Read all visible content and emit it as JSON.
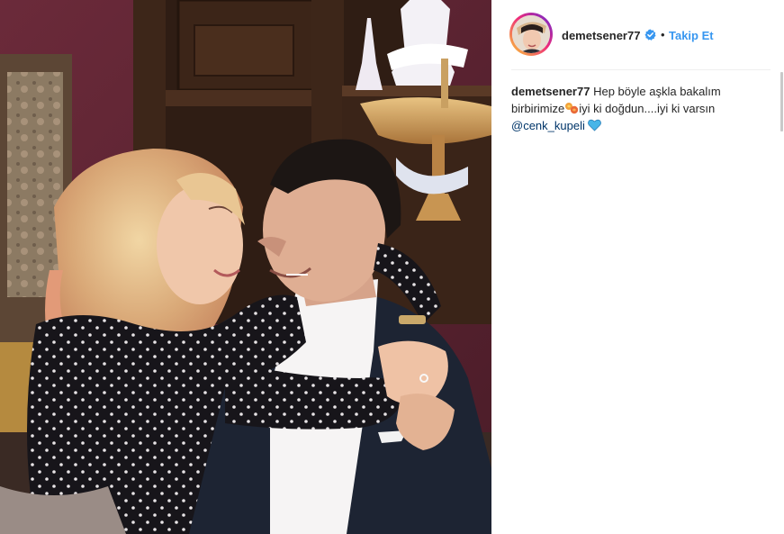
{
  "post": {
    "username": "demetsener77",
    "verified": true,
    "separator": "•",
    "follow_label": "Takip Et",
    "photo_alt": "",
    "caption": {
      "username": "demetsener77",
      "line1": "Hep böyle aşkla bakalım",
      "line2_start": "birbirimize",
      "line2_end": "iyi ki doğdun....iyi ki varsın",
      "mention": "@cenk_kupeli"
    }
  },
  "colors": {
    "follow_blue": "#3897f0",
    "mention_navy": "#003569",
    "verified_blue": "#3897f0",
    "heart_blue": "#47b5e8"
  },
  "icons": {
    "verified": "verified-badge-icon",
    "emoji1": "swirl-emoji-icon",
    "emoji2": "blue-heart-emoji-icon"
  }
}
